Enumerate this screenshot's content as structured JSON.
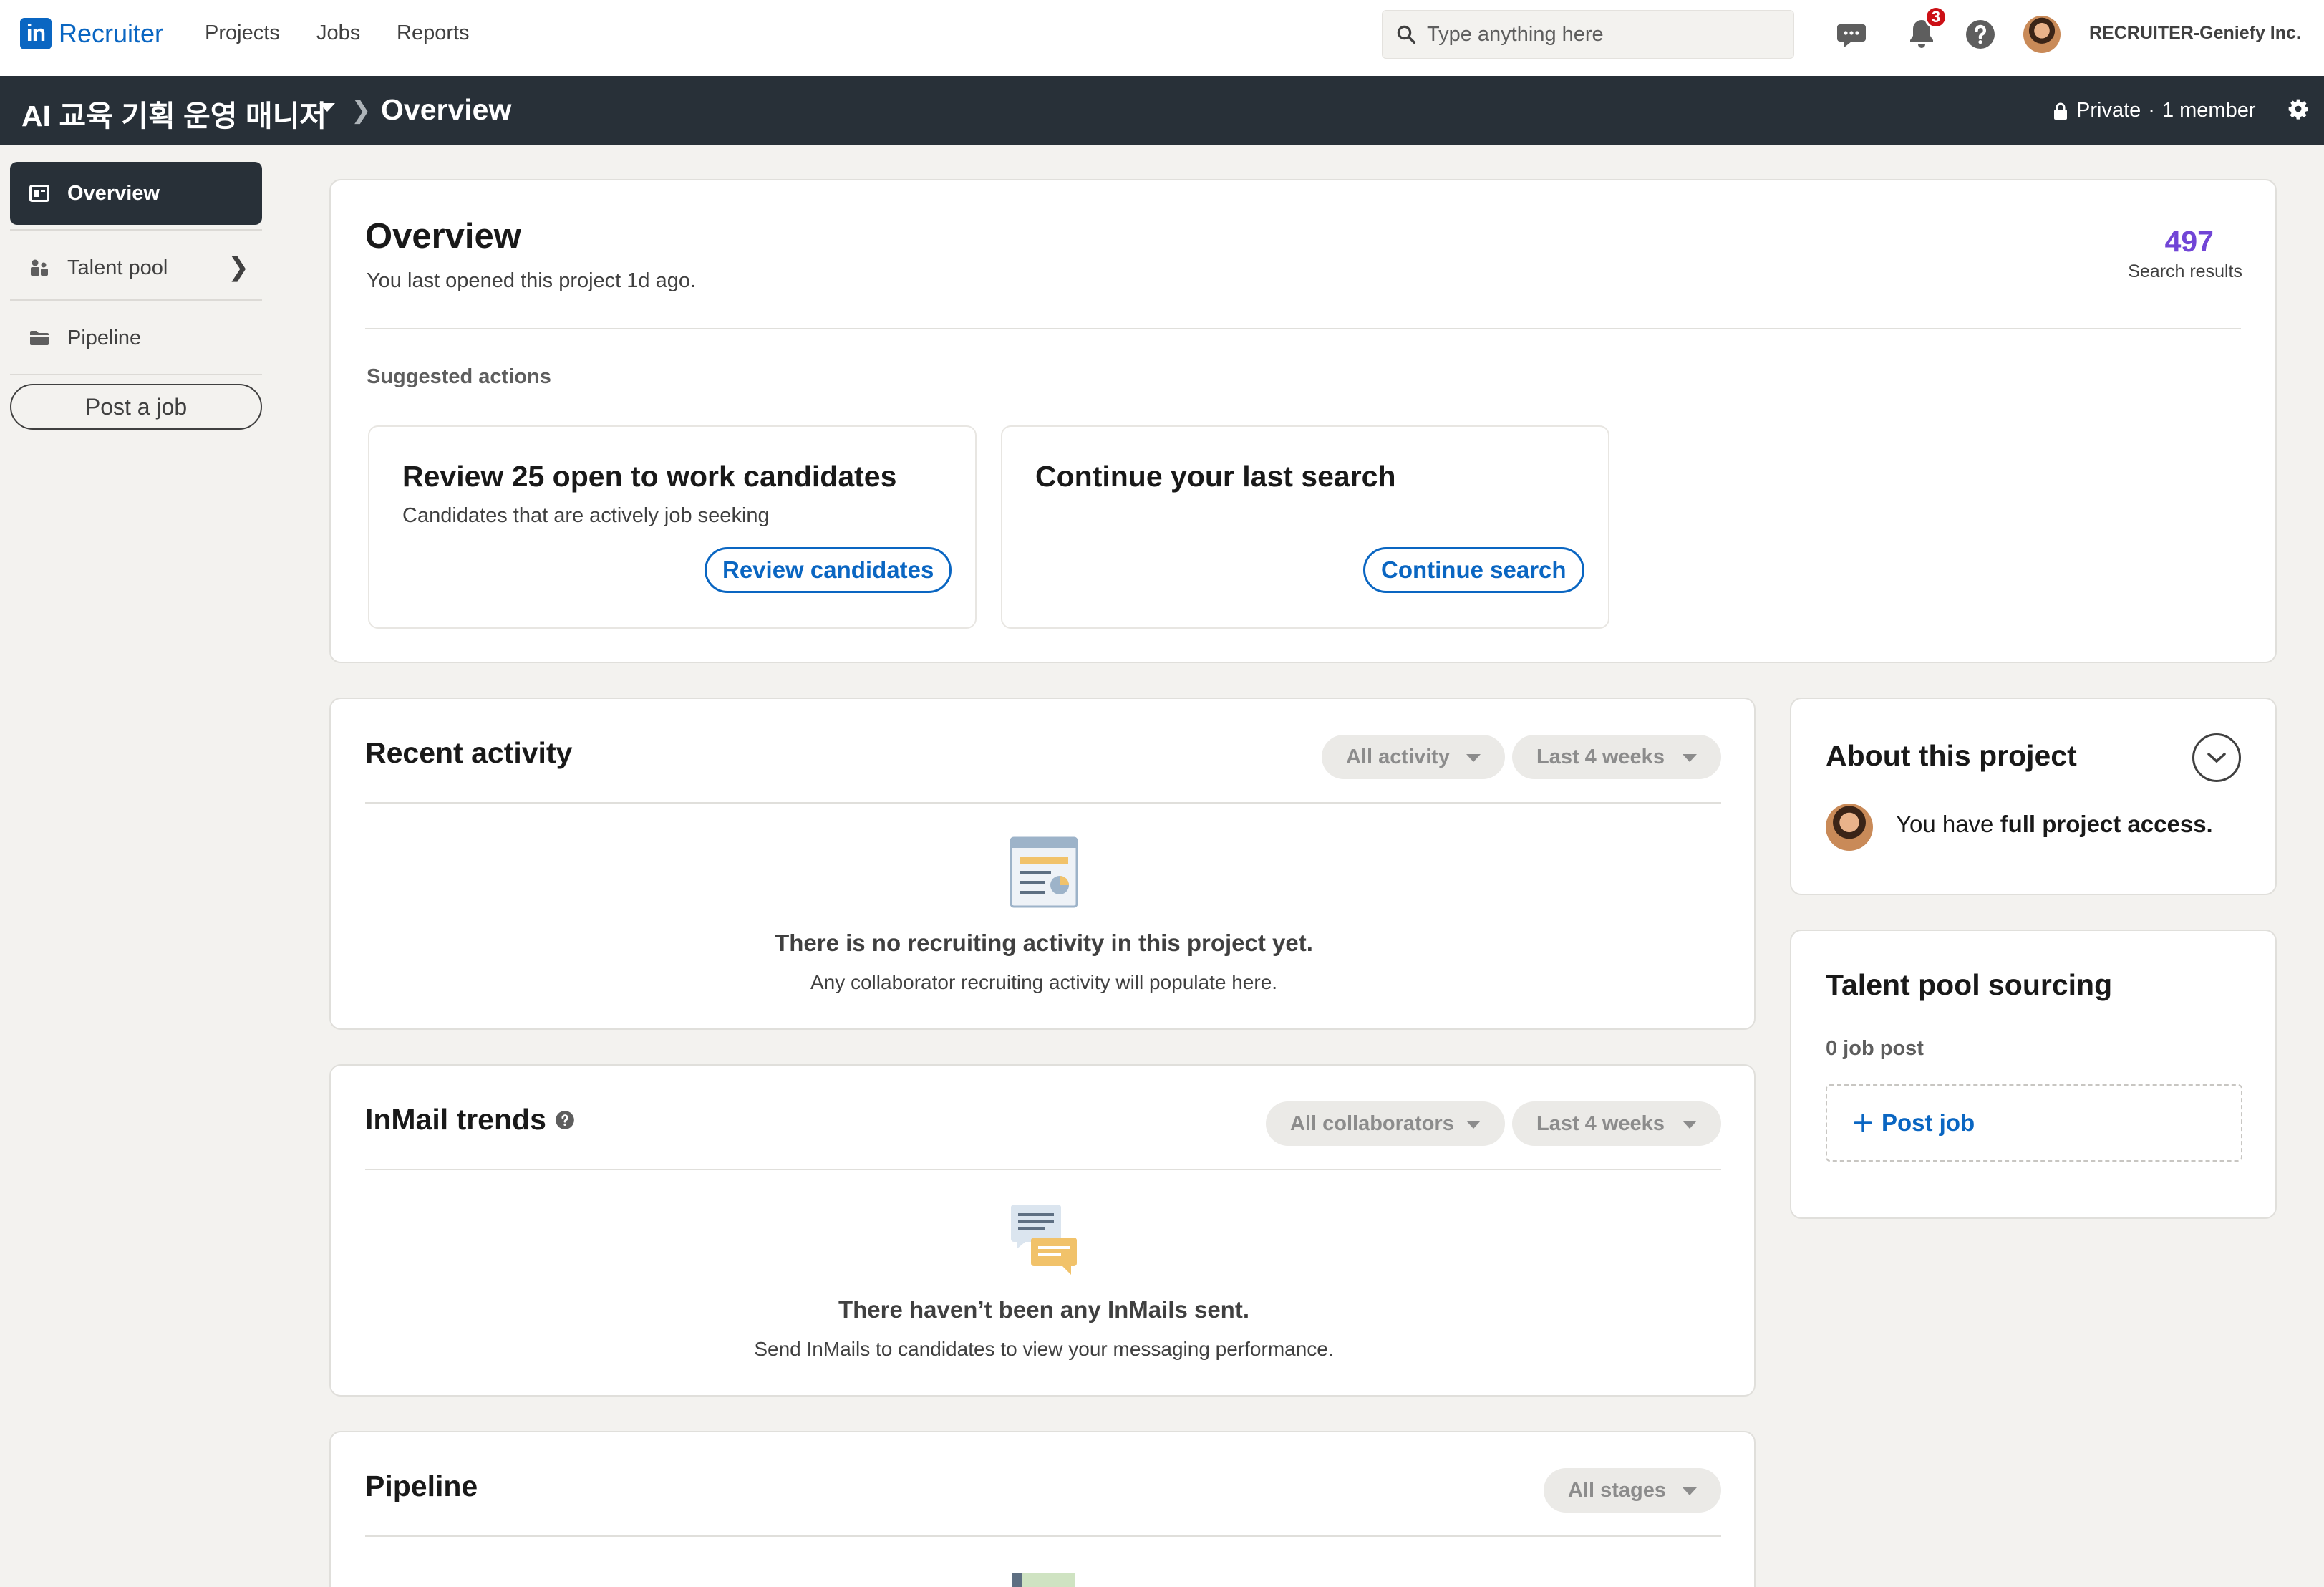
{
  "brand": {
    "logo_letters": "in",
    "product": "Recruiter"
  },
  "nav": {
    "links": [
      "Projects",
      "Jobs",
      "Reports"
    ]
  },
  "search": {
    "placeholder": "Type anything here"
  },
  "notifications": {
    "count": "3"
  },
  "account": {
    "company": "RECRUITER-Geniefy Inc."
  },
  "project": {
    "name": "AI 교육 기획 운영 매니저",
    "breadcrumb": "Overview",
    "privacy": "Private",
    "separator": "·",
    "members": "1 member"
  },
  "sidebar": {
    "items": [
      {
        "label": "Overview",
        "icon": "overview-icon"
      },
      {
        "label": "Talent pool",
        "icon": "people-icon"
      },
      {
        "label": "Pipeline",
        "icon": "folder-icon"
      }
    ],
    "post_job": "Post a job"
  },
  "overview": {
    "title": "Overview",
    "last_opened": "You last opened this project 1d ago.",
    "search_count": "497",
    "search_label": "Search results",
    "suggested_label": "Suggested actions",
    "actions": [
      {
        "title": "Review 25 open to work candidates",
        "subtitle": "Candidates that are actively job seeking",
        "button": "Review candidates"
      },
      {
        "title": "Continue your last search",
        "subtitle": "",
        "button": "Continue search"
      }
    ]
  },
  "recent_activity": {
    "title": "Recent activity",
    "filters": [
      "All activity",
      "Last 4 weeks"
    ],
    "empty_title": "There is no recruiting activity in this project yet.",
    "empty_sub": "Any collaborator recruiting activity will populate here."
  },
  "inmail": {
    "title": "InMail trends",
    "filters": [
      "All collaborators",
      "Last 4 weeks"
    ],
    "empty_title": "There haven’t been any InMails sent.",
    "empty_sub": "Send InMails to candidates to view your messaging performance."
  },
  "pipeline": {
    "title": "Pipeline",
    "filters": [
      "All stages"
    ]
  },
  "about": {
    "title": "About this project",
    "access_prefix": "You have ",
    "access_strong": "full project access."
  },
  "sourcing": {
    "title": "Talent pool sourcing",
    "count_label": "0 job post",
    "post_button": "Post job"
  },
  "colors": {
    "brand": "#0a66c2",
    "dark_bar": "#283038",
    "accent_count": "#7145d6",
    "badge": "#cc1016"
  }
}
